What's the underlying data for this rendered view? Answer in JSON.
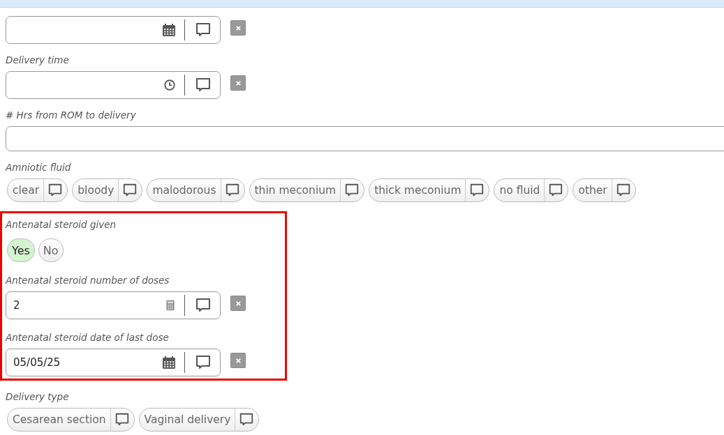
{
  "form": [
    {
      "kind": "date-field"
    },
    {
      "kind": "time-field",
      "label": "Delivery time"
    },
    {
      "kind": "wide",
      "label": "# Hrs from ROM to delivery"
    },
    {
      "kind": "chips",
      "label": "Amniotic fluid",
      "options": [
        {
          "label": "clear",
          "selected": false
        },
        {
          "label": "bloody",
          "selected": false
        },
        {
          "label": "malodorous",
          "selected": false
        },
        {
          "label": "thin meconium",
          "selected": false
        },
        {
          "label": "thick meconium",
          "selected": false
        },
        {
          "label": "no fluid",
          "selected": false
        },
        {
          "label": "other",
          "selected": false
        }
      ]
    },
    {
      "kind": "group",
      "highlighted": true,
      "children": [
        {
          "kind": "toggle",
          "label": "Antenatal steroid given",
          "options": [
            {
              "label": "Yes",
              "selected": true
            },
            {
              "label": "No",
              "selected": false
            }
          ]
        },
        {
          "kind": "number-field",
          "label": "Antenatal steroid number of doses",
          "value": "2"
        },
        {
          "kind": "date-field",
          "label": "Antenatal steroid date of last dose",
          "value": "05/05/25"
        }
      ]
    },
    {
      "kind": "chips",
      "label": "Delivery type",
      "options": [
        {
          "label": "Cesarean section",
          "selected": false
        },
        {
          "label": "Vaginal delivery",
          "selected": false
        }
      ]
    }
  ]
}
